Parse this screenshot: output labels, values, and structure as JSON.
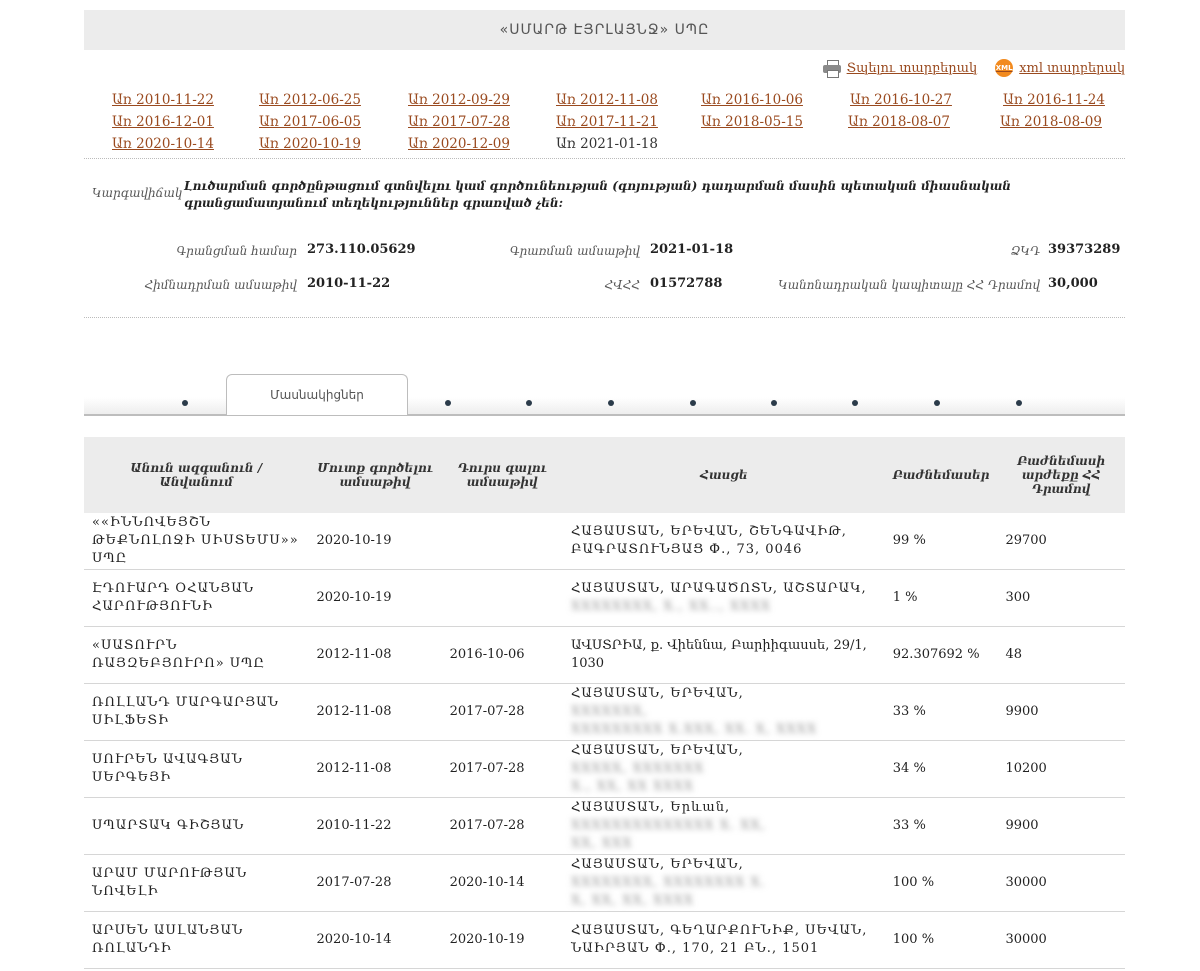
{
  "page_title": "«ՍՄԱՐԹ ԷՅՐԼԱՅՆՋ» ՍՊԸ",
  "actions": {
    "print_label": "Տպելու տարբերակ",
    "xml_label": "xml տարբերակ",
    "xml_icon_text": "XML"
  },
  "dates": {
    "row1": [
      "Առ 2010-11-22",
      "Առ 2012-06-25",
      "Առ 2012-09-29",
      "Առ 2012-11-08",
      "Առ 2016-10-06",
      "Առ 2016-10-27",
      "Առ 2016-11-24"
    ],
    "row2": [
      "Առ 2016-12-01",
      "Առ 2017-06-05",
      "Առ 2017-07-28",
      "Առ 2017-11-21",
      "Առ 2018-05-15",
      "Առ 2018-08-07",
      "Առ 2018-08-09"
    ],
    "row3": [
      "Առ 2020-10-14",
      "Առ 2020-10-19",
      "Առ 2020-12-09"
    ],
    "current": "Առ 2021-01-18"
  },
  "status": {
    "label": "Կարգավիճակ",
    "text": "Լուծարման գործընթացում գտնվելու կամ գործունեության (գոյության) դադարման մասին պետական միասնական գրանցամատյանում տեղեկություններ գրառված չեն:"
  },
  "info": {
    "reg_number_label": "Գրանցման համար",
    "reg_number": "273.110.05629",
    "record_date_label": "Գրառման ամսաթիվ",
    "record_date": "2021-01-18",
    "tin_label": "ՀՎՀՀ",
    "tin": "01572788",
    "founded_label": "Հիմնադրման ամսաթիվ",
    "founded": "2010-11-22",
    "code_label": "ՁԿԴ",
    "code": "39373289",
    "capital_label": "Կանոնադրական կապիտալը ՀՀ Դրամով",
    "capital": "30,000"
  },
  "tabs": {
    "active_label": "Մասնակիցներ",
    "dot_count": 9
  },
  "table": {
    "headers": [
      "Անուն ազգանուն / Անվանում",
      "Մուտք գործելու ամսաթիվ",
      "Դուրս գալու ամսաթիվ",
      "Հասցե",
      "Բաժնեմասեր",
      "Բաժնեմասի արժեքը ՀՀ Դրամով"
    ],
    "rows": [
      {
        "name": "««ԻՆՆՈՎԵՅՇՆ ԹԵՔՆՈԼՈՋԻ ՍԻՍՏԵՄՍ»» ՍՊԸ",
        "in": "2020-10-19",
        "out": "",
        "address": "ՀԱՅԱՍՏԱՆ, ԵՐԵՎԱՆ, ՇԵՆԳԱՎԻԹ, ԲԱԳՐԱՏՈՒՆՅԱՑ Փ., 73, 0046",
        "address_hidden": "",
        "share": "99 %",
        "value": "29700"
      },
      {
        "name": "ԷԴՈՒԱՐԴ ՕՀԱՆՅԱՆ ՀԱՐՈՒԹՅՈՒՆԻ",
        "in": "2020-10-19",
        "out": "",
        "address": "ՀԱՅԱՍՏԱՆ, ԱՐԱԳԱԾՈՏՆ, ԱՇՏԱՐԱԿ,",
        "address_hidden": "",
        "share": "1 %",
        "value": "300"
      },
      {
        "name": "«ՍԱՏՈՒՐՆ ՌԱՅԶԵԲՅՈՒՐՈ» ՍՊԸ",
        "in": "2012-11-08",
        "out": "2016-10-06",
        "address": "ԱՎՍՏՐԻԱ, ք. Վիեննա, Բարիիգասսե, 29/1, 1030",
        "address_hidden": "",
        "share": "92.307692 %",
        "value": "48"
      },
      {
        "name": "ՌՈԼԼԱՆԴ ՄԱՐԳԱՐՅԱՆ ՍԻԼՖԵՏԻ",
        "in": "2012-11-08",
        "out": "2017-07-28",
        "address": "ՀԱՅԱՍՏԱՆ, ԵՐԵՎԱՆ,",
        "address_hidden": "",
        "share": "33 %",
        "value": "9900"
      },
      {
        "name": "ՍՈՒՐԵՆ ԱՎԱԳՅԱՆ ՍԵՐԳԵՅԻ",
        "in": "2012-11-08",
        "out": "2017-07-28",
        "address": "ՀԱՅԱՍՏԱՆ, ԵՐԵՎԱՆ,",
        "address_hidden": "",
        "share": "34 %",
        "value": "10200"
      },
      {
        "name": "ՍՊԱՐՏԱԿ ԳԻՇՅԱՆ",
        "in": "2010-11-22",
        "out": "2017-07-28",
        "address": "ՀԱՅԱՍՏԱՆ, Երևան,",
        "address_hidden": "",
        "share": "33 %",
        "value": "9900"
      },
      {
        "name": "ԱՐԱՄ ՄԱՐՈՒԹՅԱՆ ՆՈՎԵԼԻ",
        "in": "2017-07-28",
        "out": "2020-10-14",
        "address": "ՀԱՅԱՍՏԱՆ, ԵՐԵՎԱՆ,",
        "address_hidden": "",
        "share": "100 %",
        "value": "30000"
      },
      {
        "name": "ԱՐՍԵՆ ԱՍԼԱՆՅԱՆ ՌՈԼԱՆԴԻ",
        "in": "2020-10-14",
        "out": "2020-10-19",
        "address": "ՀԱՅԱՍՏԱՆ, ԳԵՂԱՐՔՈՒՆԻՔ, ՍԵՎԱՆ, ՆԱԻՐՅԱՆ Փ., 170, 21 ԲՆ., 1501",
        "address_hidden": "",
        "share": "100 %",
        "value": "30000"
      }
    ]
  }
}
